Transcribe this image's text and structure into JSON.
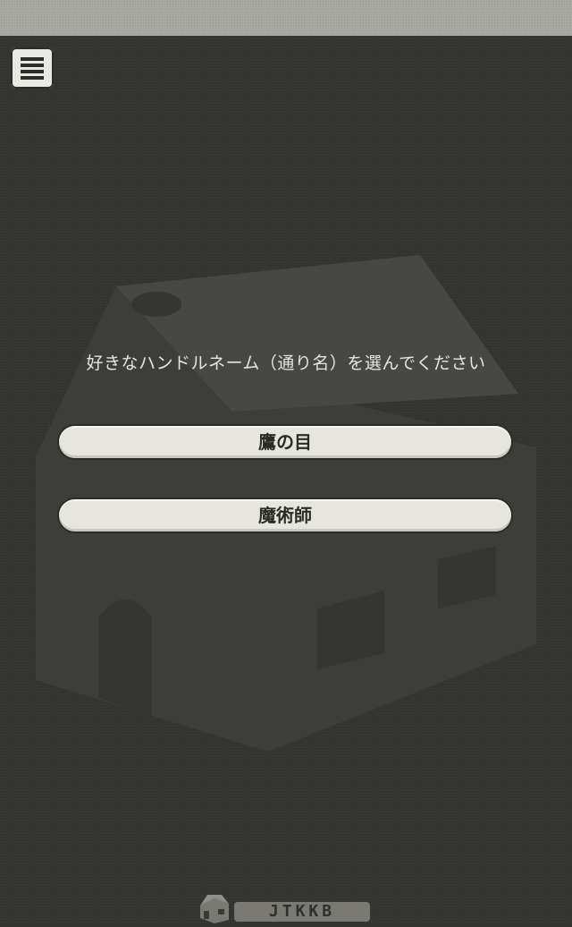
{
  "header": {
    "menu_icon": "hamburger-menu-icon"
  },
  "main": {
    "prompt": "好きなハンドルネーム（通り名）を選んでください",
    "choices": [
      {
        "label": "鷹の目"
      },
      {
        "label": "魔術師"
      }
    ]
  },
  "footer": {
    "logo_icon": "house-logo-icon",
    "brand": "JTKKB"
  },
  "colors": {
    "background": "#333330",
    "top_bar": "#a9a8a2",
    "button_fill": "#e6e5de",
    "text_light": "#e6e5df",
    "text_dark": "#2b2b28"
  }
}
